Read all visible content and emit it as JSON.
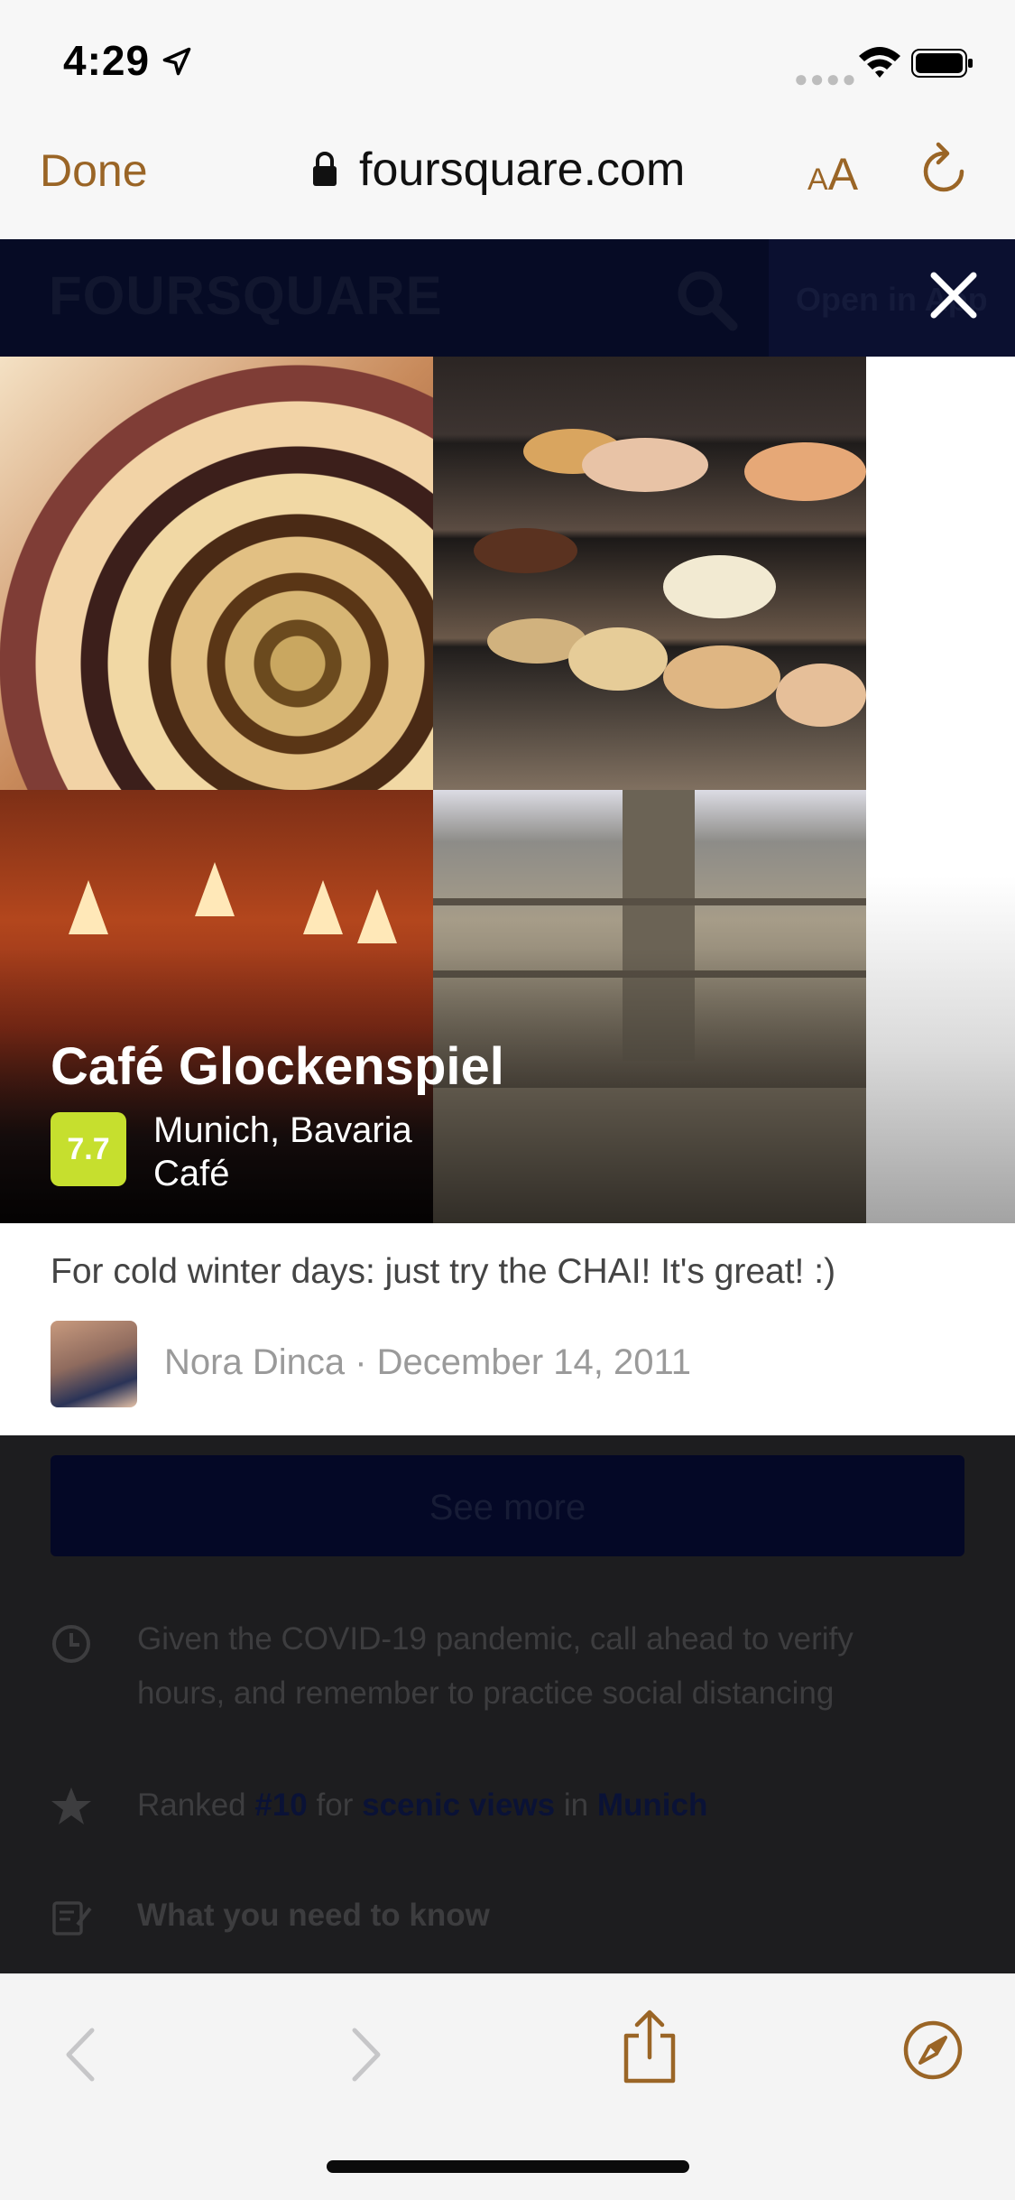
{
  "status_bar": {
    "time": "4:29"
  },
  "browser": {
    "done_label": "Done",
    "url": "foursquare.com",
    "text_size_label": "AA",
    "accent_color": "#9a6526"
  },
  "site_header": {
    "logo": "FOURSQUARE",
    "open_in_app_label": "Open in App"
  },
  "venue": {
    "name": "Café Glockenspiel",
    "score": "7.7",
    "score_color": "#c6df2e",
    "location": "Munich, Bavaria",
    "category": "Café"
  },
  "tip": {
    "text": "For cold winter days: just try the CHAI! It's great! :)",
    "author_line": "Nora Dinca · December 14, 2011"
  },
  "page": {
    "see_more_label": "See more",
    "covid_line1": "Given the COVID-19 pandemic, call ahead to verify",
    "covid_line2": "hours, and remember to practice social distancing",
    "ranked_prefix": "Ranked",
    "ranked_rank": "#10",
    "ranked_for": "for",
    "ranked_topic": "scenic views",
    "ranked_in": "in",
    "ranked_city": "Munich",
    "need_to_know": "What you need to know"
  },
  "icons": [
    "location-arrow-icon",
    "wifi-icon",
    "battery-icon",
    "lock-icon",
    "reload-icon",
    "search-icon",
    "close-icon",
    "clock-icon",
    "star-icon",
    "note-icon",
    "back-icon",
    "forward-icon",
    "share-icon",
    "compass-icon"
  ]
}
